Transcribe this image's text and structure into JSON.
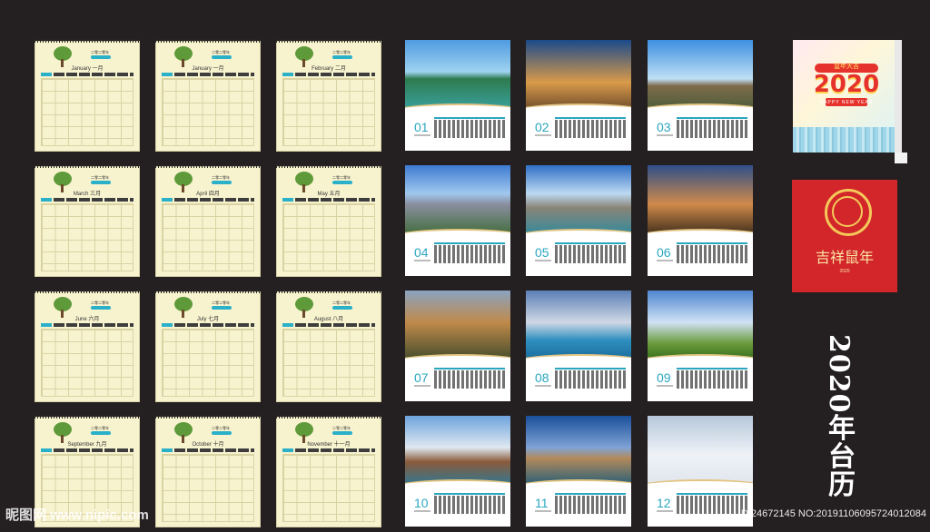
{
  "cream_calendars": [
    {
      "year_cn": "二零二零年",
      "month_en": "January",
      "month_cn": "一月"
    },
    {
      "year_cn": "二零二零年",
      "month_en": "January",
      "month_cn": "一月"
    },
    {
      "year_cn": "二零二零年",
      "month_en": "February",
      "month_cn": "二月"
    },
    {
      "year_cn": "二零二零年",
      "month_en": "March",
      "month_cn": "三月"
    },
    {
      "year_cn": "二零二零年",
      "month_en": "April",
      "month_cn": "四月"
    },
    {
      "year_cn": "二零二零年",
      "month_en": "May",
      "month_cn": "五月"
    },
    {
      "year_cn": "二零二零年",
      "month_en": "June",
      "month_cn": "六月"
    },
    {
      "year_cn": "二零二零年",
      "month_en": "July",
      "month_cn": "七月"
    },
    {
      "year_cn": "二零二零年",
      "month_en": "August",
      "month_cn": "八月"
    },
    {
      "year_cn": "二零二零年",
      "month_en": "September",
      "month_cn": "九月"
    },
    {
      "year_cn": "二零二零年",
      "month_en": "October",
      "month_cn": "十月"
    },
    {
      "year_cn": "二零二零年",
      "month_en": "November",
      "month_cn": "十一月"
    }
  ],
  "photo_calendars": [
    {
      "num": "01",
      "scene": "tropical-lagoon"
    },
    {
      "num": "02",
      "scene": "louvre"
    },
    {
      "num": "03",
      "scene": "eiffel-tower"
    },
    {
      "num": "04",
      "scene": "notre-dame"
    },
    {
      "num": "05",
      "scene": "notre-dame-river"
    },
    {
      "num": "06",
      "scene": "old-town-dusk"
    },
    {
      "num": "07",
      "scene": "european-streets"
    },
    {
      "num": "08",
      "scene": "venice"
    },
    {
      "num": "09",
      "scene": "castle"
    },
    {
      "num": "10",
      "scene": "river-town"
    },
    {
      "num": "11",
      "scene": "venice-canal"
    },
    {
      "num": "12",
      "scene": "winter-church"
    }
  ],
  "cover1": {
    "year": "2020",
    "greeting_banner": "鼠年大吉",
    "subtitle": "HAPPY NEW YEAR"
  },
  "cover2": {
    "greeting": "吉祥鼠年",
    "year": "2020"
  },
  "title_vertical": "2020年台历",
  "watermark_left": "昵图网 www.nipic.com",
  "watermark_right": "ID:24672145 NO:20191106095724012084",
  "colors": {
    "background": "#241f20",
    "accent": "#2ab0c8",
    "cream": "#f8f3cf",
    "red": "#d2262a"
  }
}
